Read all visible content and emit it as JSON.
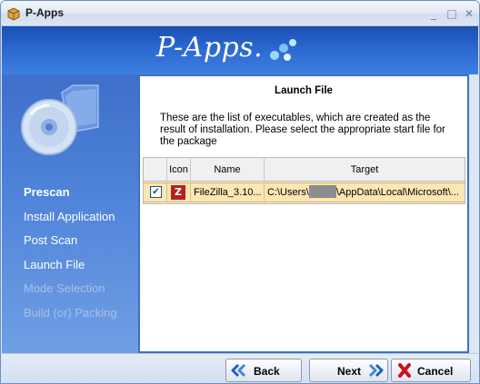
{
  "window": {
    "title": "P-Apps"
  },
  "banner": {
    "logo_text": "P-Apps."
  },
  "nav": {
    "items": [
      {
        "label": "Prescan",
        "state": "current"
      },
      {
        "label": "Install Application",
        "state": "done"
      },
      {
        "label": "Post Scan",
        "state": "done"
      },
      {
        "label": "Launch File",
        "state": "active"
      },
      {
        "label": "Mode Selection",
        "state": "disabled"
      },
      {
        "label": "Build (or) Packing",
        "state": "disabled"
      }
    ]
  },
  "content": {
    "title": "Launch File",
    "description": "These are the list of executables, which are created as the result of installation. Please select the appropriate start file for the package"
  },
  "grid": {
    "columns": [
      "",
      "Icon",
      "Name",
      "Target"
    ],
    "rows": [
      {
        "checked": true,
        "icon": "filezilla-icon",
        "name": "FileZilla_3.10...",
        "target_prefix": "C:\\Users\\",
        "target_suffix": "\\AppData\\Local\\Microsoft\\..."
      }
    ]
  },
  "buttons": {
    "back": "Back",
    "next": "Next",
    "cancel": "Cancel"
  },
  "colors": {
    "banner": "#2c6ad1",
    "nav_panel": "#4d82d8",
    "row_highlight": "#fbe6b4",
    "cancel_red": "#c8101e"
  }
}
